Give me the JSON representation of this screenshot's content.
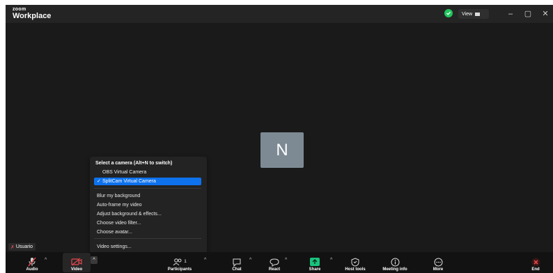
{
  "titlebar": {
    "brand_small": "zoom",
    "brand_large": "Workplace",
    "view_label": "View",
    "shield_icon": "shield-check-icon",
    "window_controls": [
      "minimize-icon",
      "maximize-icon",
      "close-icon"
    ]
  },
  "stage": {
    "avatar_initial": "N",
    "participant_name": "Usuario"
  },
  "camera_menu": {
    "header": "Select a camera (Alt+N to switch)",
    "cameras": [
      "OBS Virtual Camera",
      "SplitCam Virtual Camera"
    ],
    "selected_camera": "SplitCam Virtual Camera",
    "options": [
      "Blur my background",
      "Auto-frame my video",
      "Adjust background & effects...",
      "Choose video filter...",
      "Choose avatar..."
    ],
    "settings": "Video settings..."
  },
  "toolbar": {
    "audio": "Audio",
    "video": "Video",
    "participants": "Participants",
    "participants_count": "1",
    "chat": "Chat",
    "react": "React",
    "share": "Share",
    "host_tools": "Host tools",
    "meeting_info": "Meeting info",
    "more": "More",
    "end": "End"
  },
  "colors": {
    "accent": "#0e72ed",
    "share_green": "#19c37d",
    "end_red": "#e5484d",
    "background": "#1a1a1a"
  }
}
